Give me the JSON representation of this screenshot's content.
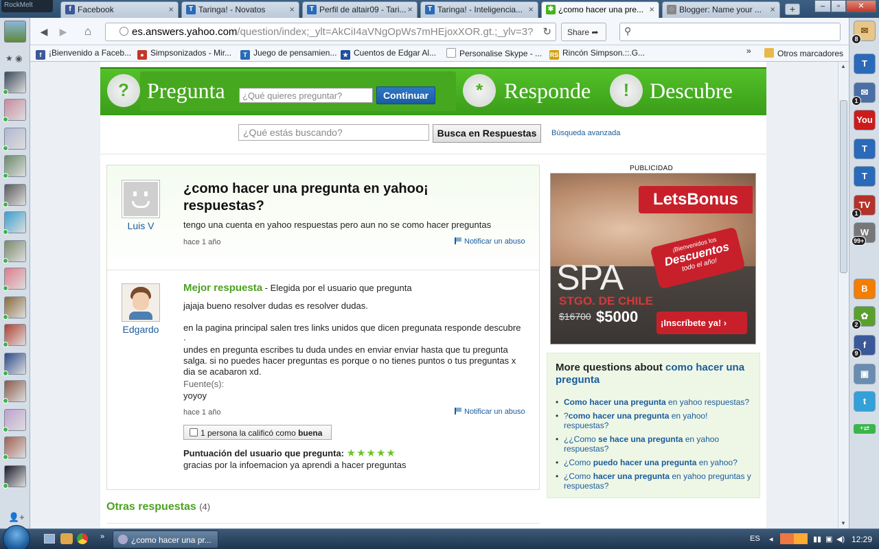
{
  "browser": {
    "app_label": "RockMelt",
    "tabs": [
      {
        "title": "Facebook",
        "icon": "f",
        "color": "#3b5998"
      },
      {
        "title": "Taringa! - Novatos",
        "icon": "T",
        "color": "#2a6ab8"
      },
      {
        "title": "Perfil de altair09 - Tari...",
        "icon": "T",
        "color": "#2a6ab8"
      },
      {
        "title": "Taringa! - Inteligencia...",
        "icon": "T",
        "color": "#2a6ab8"
      },
      {
        "title": "¿como hacer una pre...",
        "icon": "✱",
        "color": "#46b21a"
      },
      {
        "title": "Blogger: Name your ...",
        "icon": "◌",
        "color": "#888888"
      }
    ],
    "url_host": "es.answers.yahoo.com",
    "url_path": "/question/index;_ylt=AkCiI4aVNgOpWs7mHEjoxXOR.gt.;_ylv=3?",
    "share_label": "Share",
    "bookmarks": [
      {
        "label": "¡Bienvenido a Faceb...",
        "icon": "f",
        "color": "#3b5998"
      },
      {
        "label": "Simpsonizados - Mir...",
        "icon": "●",
        "color": "#c0392b"
      },
      {
        "label": "Juego de pensamien...",
        "icon": "T",
        "color": "#2a6ab8"
      },
      {
        "label": "Cuentos de Edgar Al...",
        "icon": "★",
        "color": "#1f4fa0"
      },
      {
        "label": "Personalise Skype - ...",
        "icon": " ",
        "color": "#ffffff"
      },
      {
        "label": "Rincón Simpson.::.G...",
        "icon": "RS",
        "color": "#d4a017"
      }
    ],
    "bookmarks_more": "»",
    "bookmarks_other": "Otros marcadores"
  },
  "rightbar": {
    "items": [
      {
        "icon": "T",
        "color": "#2a6ab8",
        "badge": ""
      },
      {
        "icon": "✉",
        "color": "#4a6fa5",
        "badge": "1"
      },
      {
        "icon": "You",
        "color": "#cc1b1b",
        "badge": ""
      },
      {
        "icon": "T",
        "color": "#2a6ab8",
        "badge": ""
      },
      {
        "icon": "T",
        "color": "#2a6ab8",
        "badge": ""
      },
      {
        "icon": "TV",
        "color": "#b5322b",
        "badge": "1"
      },
      {
        "icon": "W",
        "color": "#777777",
        "badge": "99+"
      },
      {
        "icon": "B",
        "color": "#f57d00",
        "badge": ""
      },
      {
        "icon": "✿",
        "color": "#5aa02c",
        "badge": "2"
      },
      {
        "icon": "f",
        "color": "#3b5998",
        "badge": "9"
      },
      {
        "icon": "▣",
        "color": "#6a8caf",
        "badge": ""
      },
      {
        "icon": "t",
        "color": "#33a0d8",
        "badge": ""
      }
    ],
    "top_badge": "8"
  },
  "yahoo": {
    "nav": {
      "ask_title": "Pregunta",
      "ask_placeholder": "¿Qué quieres preguntar?",
      "continue_label": "Continuar",
      "answer_title": "Responde",
      "discover_title": "Descubre"
    },
    "search": {
      "placeholder": "¿Qué estás buscando?",
      "button": "Busca en Respuestas",
      "advanced": "Búsqueda avanzada"
    },
    "question": {
      "user": "Luis V",
      "title": "¿como hacer una pregunta en yahoo¡ respuestas?",
      "body": "tengo una cuenta en yahoo respuestas pero aun no se como hacer preguntas",
      "time": "hace 1 año",
      "report": "Notificar un abuso"
    },
    "best_answer": {
      "label": "Mejor respuesta",
      "sublabel": " - Elegida por el usuario que pregunta",
      "user": "Edgardo",
      "p1": "jajaja bueno resolver dudas es resolver dudas.",
      "p2": "en la pagina principal salen tres links unidos que dicen pregunata responde descubre",
      "p2b": ".",
      "p3": "undes en pregunta escribes tu duda undes en enviar enviar hasta que tu pregunta salga. si no puedes hacer preguntas es porque o no tienes puntos o tus preguntas x dia se acabaron xd.",
      "source_label": "Fuente(s):",
      "source": "yoyoy",
      "time": "hace 1 año",
      "report": "Notificar un abuso",
      "rating_prefix": "1 persona la calificó como ",
      "rating_word": "buena",
      "asker_rating_label": "Puntuación del usuario que pregunta:",
      "stars": "★★★★★",
      "asker_comment": "gracias por la infoemacion ya aprendi a hacer preguntas"
    },
    "other_answers": {
      "label": "Otras respuestas",
      "count": "(4)"
    },
    "ad": {
      "label": "PUBLICIDAD",
      "brand": "LetsBonus",
      "tag_line1": "¡Bienvenidos los",
      "tag_line2": "Descuentos",
      "tag_line3": "todo el año!",
      "spa": "SPA",
      "city": "STGO. DE CHILE",
      "old_price": "$16700",
      "new_price": "$5000",
      "cta": "¡Inscríbete ya!"
    },
    "more_questions": {
      "title_prefix": "More questions about ",
      "title_link": "como hacer una pregunta",
      "items": [
        {
          "pre": "",
          "bold": "Como hacer una pregunta",
          "post": " en yahoo respuestas?"
        },
        {
          "pre": "?",
          "bold": "como hacer una pregunta",
          "post": " en yahoo! respuestas?"
        },
        {
          "pre": "¿¿Como ",
          "bold": "se hace una pregunta",
          "post": " en yahoo respuestas?"
        },
        {
          "pre": "¿Como ",
          "bold": "puedo hacer una pregunta",
          "post": " en yahoo?"
        },
        {
          "pre": "¿Como ",
          "bold": "hacer una pregunta",
          "post": " en yahoo preguntas y respuestas?"
        }
      ]
    }
  },
  "taskbar": {
    "window_title": "¿como hacer una pr...",
    "lang": "ES",
    "clock": "12:29"
  }
}
